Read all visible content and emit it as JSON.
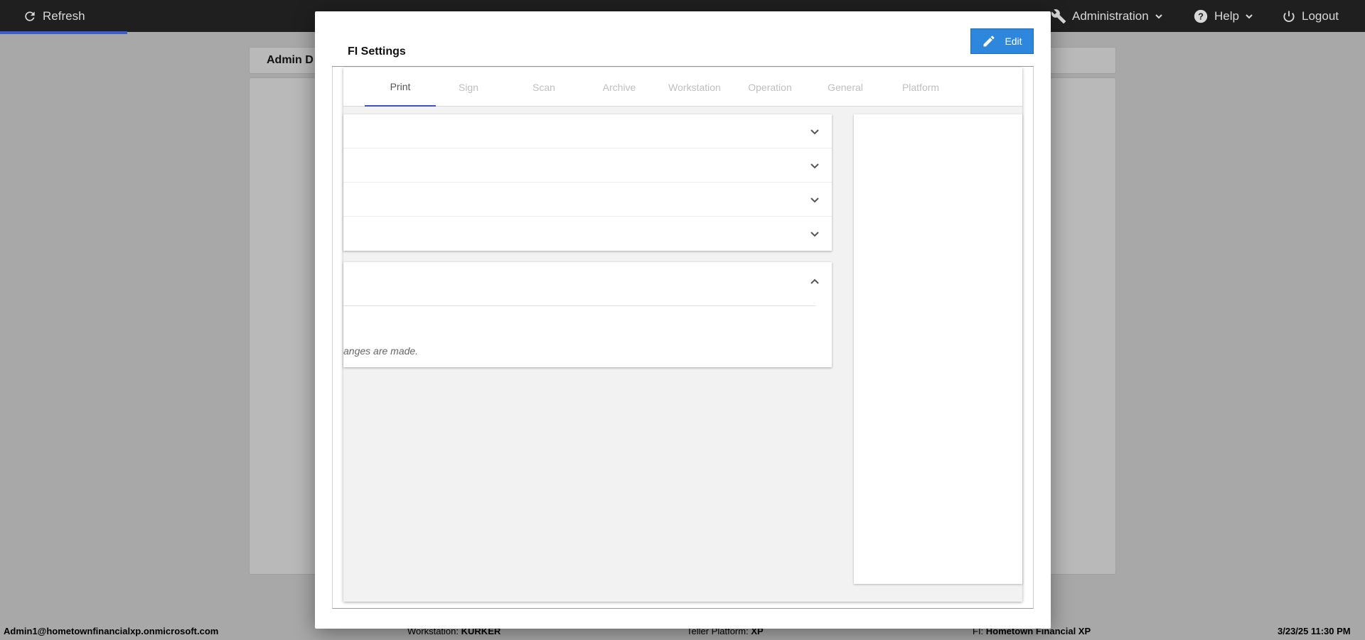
{
  "topbar": {
    "refresh_label": "Refresh",
    "administration_label": "Administration",
    "help_label": "Help",
    "logout_label": "Logout"
  },
  "background": {
    "card_title": "Admin D"
  },
  "status_bar": {
    "user": "Admin1@hometownfinancialxp.onmicrosoft.com",
    "workstation_label": "Workstation:",
    "workstation_value": "KURKER",
    "platform_label": "Teller Platform:",
    "platform_value": "XP",
    "fi_label": "FI:",
    "fi_value": "Hometown Financial XP",
    "datetime": "3/23/25 11:30 PM"
  },
  "modal": {
    "title": "FI Settings",
    "edit_label": "Edit",
    "tabs": [
      {
        "label": "Print",
        "active": true
      },
      {
        "label": "Sign",
        "active": false
      },
      {
        "label": "Scan",
        "active": false
      },
      {
        "label": "Archive",
        "active": false
      },
      {
        "label": "Workstation",
        "active": false
      },
      {
        "label": "Operation",
        "active": false
      },
      {
        "label": "General",
        "active": false
      },
      {
        "label": "Platform",
        "active": false
      }
    ],
    "expanded_note": "anges are made."
  },
  "colors": {
    "accent": "#2d87dc",
    "tab_indicator": "#3b51c4",
    "topbar": "#1f1f1f",
    "overlay": "#a8a8a8"
  }
}
